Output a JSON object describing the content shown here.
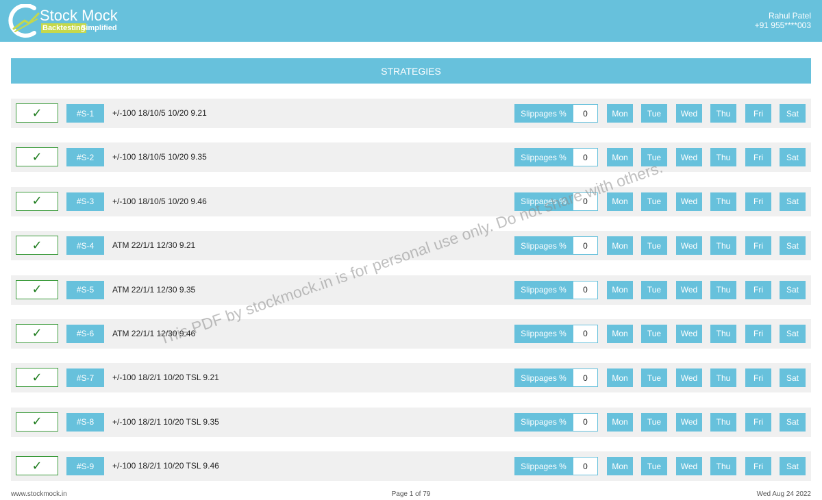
{
  "header": {
    "logo_title": "Stock Mock",
    "logo_tag_highlight": "Backtesting",
    "logo_tag_rest": "Simplified",
    "user_name": "Rahul Patel",
    "user_phone": "+91 955****003"
  },
  "section_title": "STRATEGIES",
  "labels": {
    "check": "✓",
    "slippage": "Slippages %",
    "days": [
      "Mon",
      "Tue",
      "Wed",
      "Thu",
      "Fri",
      "Sat"
    ]
  },
  "strategies": [
    {
      "id": "#S-1",
      "name": "+/-100 18/10/5 10/20 9.21",
      "slippage": "0"
    },
    {
      "id": "#S-2",
      "name": "+/-100 18/10/5 10/20 9.35",
      "slippage": "0"
    },
    {
      "id": "#S-3",
      "name": "+/-100 18/10/5 10/20 9.46",
      "slippage": "0"
    },
    {
      "id": "#S-4",
      "name": "ATM 22/1/1 12/30 9.21",
      "slippage": "0"
    },
    {
      "id": "#S-5",
      "name": "ATM 22/1/1 12/30 9.35",
      "slippage": "0"
    },
    {
      "id": "#S-6",
      "name": "ATM 22/1/1 12/30 9.46",
      "slippage": "0"
    },
    {
      "id": "#S-7",
      "name": "+/-100 18/2/1 10/20 TSL 9.21",
      "slippage": "0"
    },
    {
      "id": "#S-8",
      "name": "+/-100 18/2/1 10/20 TSL 9.35",
      "slippage": "0"
    },
    {
      "id": "#S-9",
      "name": "+/-100 18/2/1 10/20 TSL 9.46",
      "slippage": "0"
    }
  ],
  "watermark": "This PDF by stockmock.in is for personal use only. Do not share with others.",
  "footer": {
    "site": "www.stockmock.in",
    "page": "Page 1 of 79",
    "date": "Wed Aug 24 2022"
  },
  "colors": {
    "accent": "#67c1dc",
    "row_bg": "#f0f0f0",
    "check_border": "#3a9a3a",
    "logo_highlight": "#c5d84a"
  }
}
